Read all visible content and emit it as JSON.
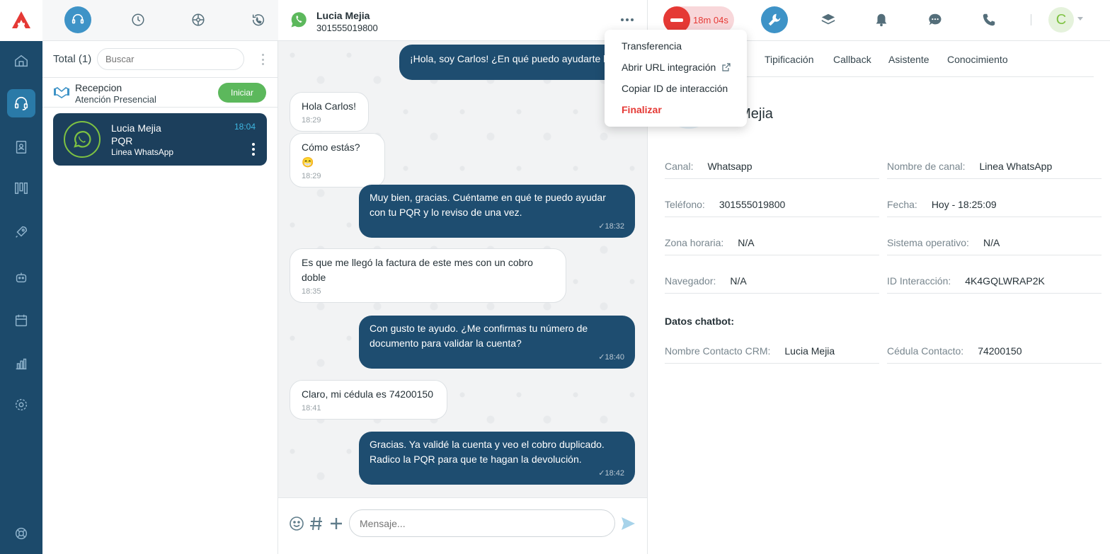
{
  "list": {
    "total_label": "Total (1)",
    "search_placeholder": "Buscar",
    "queue": {
      "name": "Recepcion",
      "sub": "Atención Presencial",
      "button": "Iniciar"
    },
    "conversation": {
      "name": "Lucia Mejia",
      "sub1": "PQR",
      "sub2": "Linea WhatsApp",
      "time": "18:04"
    }
  },
  "chat": {
    "name": "Lucia Mejia",
    "phone": "301555019800",
    "messages": [
      {
        "dir": "out",
        "text": "¡Hola, soy Carlos! ¿En qué puedo ayudarte hoy?",
        "time": "✓"
      },
      {
        "dir": "in",
        "text": "Hola Carlos!",
        "time": "18:29"
      },
      {
        "dir": "in",
        "text": "Cómo estás? 😁",
        "time": "18:29"
      },
      {
        "dir": "out",
        "text": "Muy bien, gracias. Cuéntame en qué te puedo ayudar con tu PQR y lo reviso de una vez.",
        "time": "✓18:32"
      },
      {
        "dir": "in",
        "text": "Es que me llegó la factura de este mes con un cobro doble",
        "time": "18:35"
      },
      {
        "dir": "out",
        "text": "Con gusto te ayudo. ¿Me confirmas tu número de documento para validar la cuenta?",
        "time": "✓18:40"
      },
      {
        "dir": "in",
        "text": "Claro, mi cédula es 74200150",
        "time": "18:41"
      },
      {
        "dir": "out",
        "text": "Gracias. Ya validé la cuenta y veo el cobro duplicado. Radico la PQR para que te hagan la devolución.",
        "time": "✓18:42"
      }
    ],
    "input_placeholder": "Mensaje..."
  },
  "header": {
    "timer": "18m 04s",
    "user_initial": "C"
  },
  "menu": {
    "items": [
      "Transferencia",
      "Abrir URL integración",
      "Copiar ID de interacción"
    ],
    "danger": "Finalizar"
  },
  "tabs": [
    "Tipificación",
    "Callback",
    "Asistente",
    "Conocimiento"
  ],
  "profile": {
    "name": "ia Mejia",
    "fields": {
      "canal": {
        "label": "Canal:",
        "value": "Whatsapp"
      },
      "nombre_canal": {
        "label": "Nombre de canal:",
        "value": "Linea WhatsApp"
      },
      "telefono": {
        "label": "Teléfono:",
        "value": "301555019800"
      },
      "fecha": {
        "label": "Fecha:",
        "value": "Hoy - 18:25:09"
      },
      "zona": {
        "label": "Zona horaria:",
        "value": "N/A"
      },
      "so": {
        "label": "Sistema operativo:",
        "value": "N/A"
      },
      "navegador": {
        "label": "Navegador:",
        "value": "N/A"
      },
      "id_int": {
        "label": "ID Interacción:",
        "value": "4K4GQLWRAP2K"
      },
      "crm": {
        "label": "Nombre Contacto CRM:",
        "value": "Lucia Mejia"
      },
      "cedula": {
        "label": "Cédula Contacto:",
        "value": "74200150"
      }
    },
    "section": "Datos chatbot:"
  },
  "colors": {
    "nav": "#1c4a6b",
    "accent": "#3e93c7",
    "bubble_out": "#1e4d70",
    "danger": "#e53935",
    "green": "#5cb85c"
  }
}
